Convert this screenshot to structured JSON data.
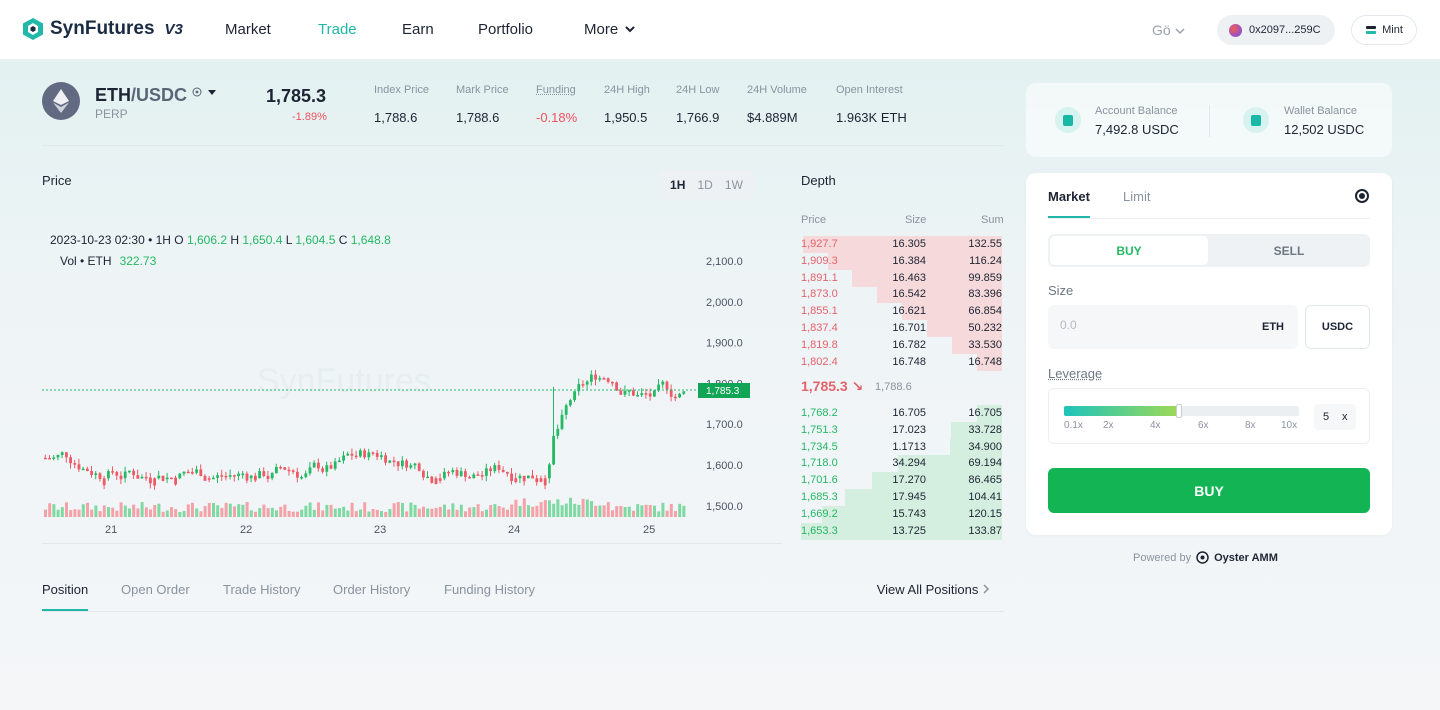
{
  "brand": {
    "name": "SynFutures",
    "version": "V3"
  },
  "nav": {
    "items": [
      {
        "label": "Market",
        "active": false
      },
      {
        "label": "Trade",
        "active": true
      },
      {
        "label": "Earn",
        "active": false
      },
      {
        "label": "Portfolio",
        "active": false
      },
      {
        "label": "More",
        "active": false
      }
    ],
    "network": "Gö",
    "wallet_address": "0x2097...259C",
    "mint_label": "Mint"
  },
  "market": {
    "base": "ETH",
    "quote": "/USDC",
    "type": "PERP",
    "last_price": "1,785.3",
    "change": "-1.89%",
    "stats": [
      {
        "label": "Index Price",
        "value": "1,788.6"
      },
      {
        "label": "Mark Price",
        "value": "1,788.6"
      },
      {
        "label": "Funding",
        "value": "-0.18%"
      },
      {
        "label": "24H High",
        "value": "1,950.5"
      },
      {
        "label": "24H Low",
        "value": "1,766.9"
      },
      {
        "label": "24H Volume",
        "value": "$4.889M"
      },
      {
        "label": "Open Interest",
        "value": "1.963K ETH"
      }
    ]
  },
  "chart": {
    "title": "Price",
    "timeframes": [
      "1H",
      "1D",
      "1W"
    ],
    "active_timeframe": "1H",
    "ohlc": {
      "date": "2023-10-23 02:30",
      "interval": "1H",
      "o": "1,606.2",
      "h": "1,650.4",
      "l": "1,604.5",
      "c": "1,648.8"
    },
    "volume": {
      "label": "Vol • ETH",
      "value": "322.73"
    },
    "y_ticks": [
      "2,100.0",
      "2,000.0",
      "1,900.0",
      "1,800.0",
      "1,700.0",
      "1,600.0",
      "1,500.0"
    ],
    "x_ticks": [
      "21",
      "22",
      "23",
      "24",
      "25"
    ],
    "current_price_tag": "1,785.3",
    "watermark": "SynFutures"
  },
  "depth": {
    "title": "Depth",
    "headers": {
      "price": "Price",
      "size": "Size",
      "sum": "Sum"
    },
    "asks": [
      {
        "price": "1,927.7",
        "size": "16.305",
        "sum": "132.55"
      },
      {
        "price": "1,909.3",
        "size": "16.384",
        "sum": "116.24"
      },
      {
        "price": "1,891.1",
        "size": "16.463",
        "sum": "99.859"
      },
      {
        "price": "1,873.0",
        "size": "16.542",
        "sum": "83.396"
      },
      {
        "price": "1,855.1",
        "size": "16.621",
        "sum": "66.854"
      },
      {
        "price": "1,837.4",
        "size": "16.701",
        "sum": "50.232"
      },
      {
        "price": "1,819.8",
        "size": "16.782",
        "sum": "33.530"
      },
      {
        "price": "1,802.4",
        "size": "16.748",
        "sum": "16.748"
      }
    ],
    "mid": {
      "price": "1,785.3 ↘",
      "mark": "1,788.6"
    },
    "bids": [
      {
        "price": "1,768.2",
        "size": "16.705",
        "sum": "16.705"
      },
      {
        "price": "1,751.3",
        "size": "17.023",
        "sum": "33.728"
      },
      {
        "price": "1,734.5",
        "size": "1.1713",
        "sum": "34.900"
      },
      {
        "price": "1,718.0",
        "size": "34.294",
        "sum": "69.194"
      },
      {
        "price": "1,701.6",
        "size": "17.270",
        "sum": "86.465"
      },
      {
        "price": "1,685.3",
        "size": "17.945",
        "sum": "104.41"
      },
      {
        "price": "1,669.2",
        "size": "15.743",
        "sum": "120.15"
      },
      {
        "price": "1,653.3",
        "size": "13.725",
        "sum": "133.87"
      }
    ]
  },
  "bottom_tabs": {
    "items": [
      "Position",
      "Open Order",
      "Trade History",
      "Order History",
      "Funding History"
    ],
    "active": "Position",
    "view_all": "View All Positions"
  },
  "balances": {
    "account": {
      "label": "Account Balance",
      "value": "7,492.8 USDC"
    },
    "wallet": {
      "label": "Wallet Balance",
      "value": "12,502 USDC"
    }
  },
  "trade": {
    "tabs": [
      "Market",
      "Limit"
    ],
    "active_tab": "Market",
    "buy_label": "BUY",
    "sell_label": "SELL",
    "size_label": "Size",
    "size_placeholder": "0.0",
    "size_unit": "ETH",
    "alt_unit": "USDC",
    "leverage_label": "Leverage",
    "leverage_ticks": [
      "0.1x",
      "2x",
      "4x",
      "6x",
      "8x",
      "10x"
    ],
    "leverage_value": "5",
    "leverage_suffix": "x",
    "leverage_fraction": 0.49,
    "submit_label": "BUY"
  },
  "footer": {
    "powered_by": "Powered by",
    "provider": "Oyster AMM"
  }
}
